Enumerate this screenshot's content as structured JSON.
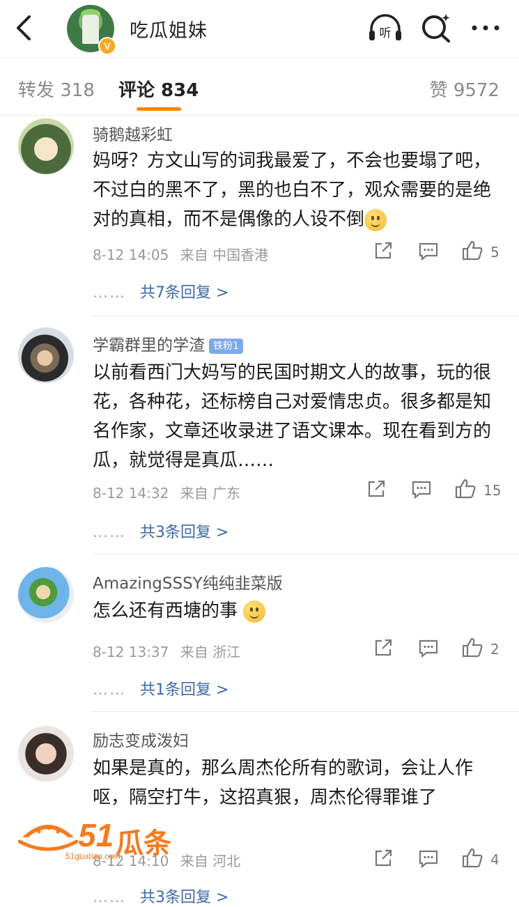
{
  "header": {
    "title": "吃瓜姐妹",
    "verified_badge": "V",
    "icons": [
      "back-icon",
      "listen-icon",
      "search-icon",
      "more-icon"
    ],
    "listen_label": "听"
  },
  "tabs": {
    "repost": "转发 318",
    "comment": "评论 834",
    "likes": "赞 9572",
    "active": "comment",
    "accent_color": "#ff8200"
  },
  "comments": [
    {
      "name": "骑鹅越彩虹",
      "text": "妈呀？方文山写的词我最爱了，不会也要塌了吧，不过白的黑不了，黑的也白不了，观众需要的是绝对的真相，而不是偶像的人设不倒",
      "time": "8-12 14:05",
      "source": "来自 中国香港",
      "likes": "5",
      "replies": "共7条回复 >"
    },
    {
      "name": "学霸群里的学渣",
      "badge": "铁粉1",
      "text": "以前看西门大妈写的民国时期文人的故事，玩的很花，各种花，还标榜自己对爱情忠贞。很多都是知名作家，文章还收录进了语文课本。现在看到方的瓜，就觉得是真瓜……",
      "time": "8-12 14:32",
      "source": "来自 广东",
      "likes": "15",
      "replies": "共3条回复 >"
    },
    {
      "name": "AmazingSSSY纯纯韭菜版",
      "text": "怎么还有西塘的事",
      "time": "8-12 13:37",
      "source": "来自 浙江",
      "likes": "2",
      "replies": "共1条回复 >"
    },
    {
      "name": "励志变成泼妇",
      "text": "如果是真的，那么周杰伦所有的歌词，会让人作呕，隔空打牛，这招真狠，周杰伦得罪谁了",
      "time": "8-12 14:10",
      "source": "来自 河北",
      "likes": "4",
      "replies": "共3条回复 >"
    }
  ],
  "replies_dots": "……",
  "watermark": {
    "number": "51",
    "chinese": "瓜条",
    "url": "51guatiao.com"
  }
}
